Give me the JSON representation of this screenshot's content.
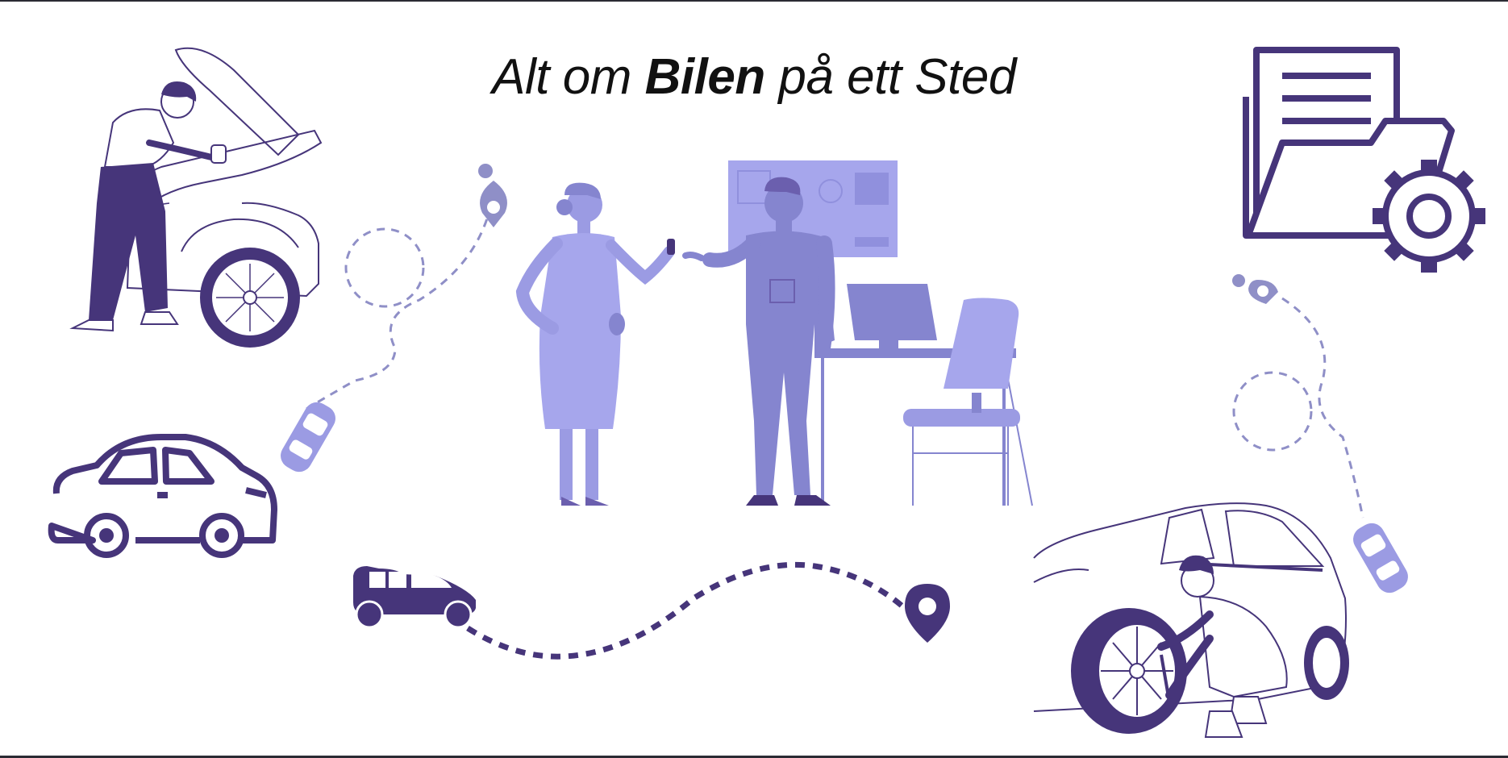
{
  "title": {
    "part1": "Alt om ",
    "bold": "Bilen",
    "part2": " på ett Sted"
  },
  "colors": {
    "dark_purple": "#46357a",
    "light_purple": "#9b9be3",
    "mid_purple": "#8585cf",
    "line_gray": "#7a7a8a",
    "background": "#ffffff",
    "text": "#111111"
  },
  "icons": [
    "mechanic-under-hood",
    "car-outline-icon",
    "route-car-icon",
    "location-pin-icon",
    "folder-gear-icon",
    "car-key-handover-scene",
    "tire-change-mechanic"
  ]
}
